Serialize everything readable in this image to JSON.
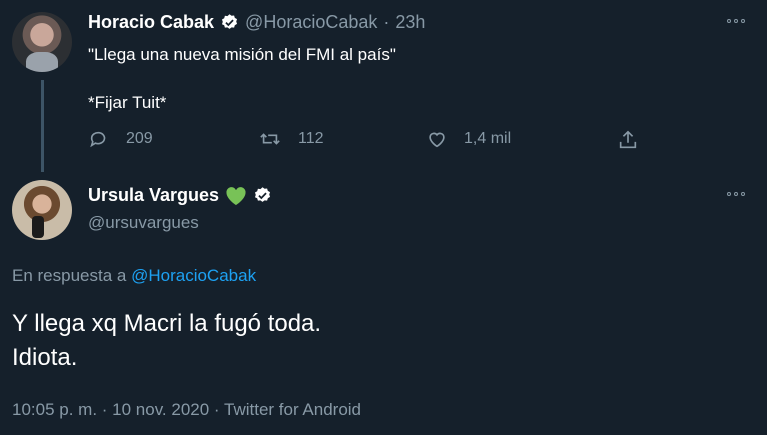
{
  "tweet1": {
    "name": "Horacio Cabak",
    "handle": "@HoracioCabak",
    "separator": "·",
    "time": "23h",
    "text_line1": "\"Llega una nueva misión del FMI al país\"",
    "text_line2": "*Fijar Tuit*",
    "replies": "209",
    "retweets": "112",
    "likes": "1,4 mil"
  },
  "tweet2": {
    "name": "Ursula Vargues",
    "name_emoji": "💚",
    "handle": "@ursuvargues",
    "reply_prefix": "En respuesta a",
    "reply_to": "@HoracioCabak",
    "text_line1": "Y llega xq Macri la fugó toda.",
    "text_line2": "Idiota.",
    "meta": "10:05 p. m. · 10 nov. 2020 · Twitter for Android"
  },
  "colors": {
    "background": "#15202b",
    "muted": "#8899a6",
    "link": "#1da1f2",
    "heart": "#78c257"
  },
  "icons": [
    "reply-icon",
    "retweet-icon",
    "like-icon",
    "share-icon",
    "verified-badge-icon",
    "more-options-icon"
  ]
}
